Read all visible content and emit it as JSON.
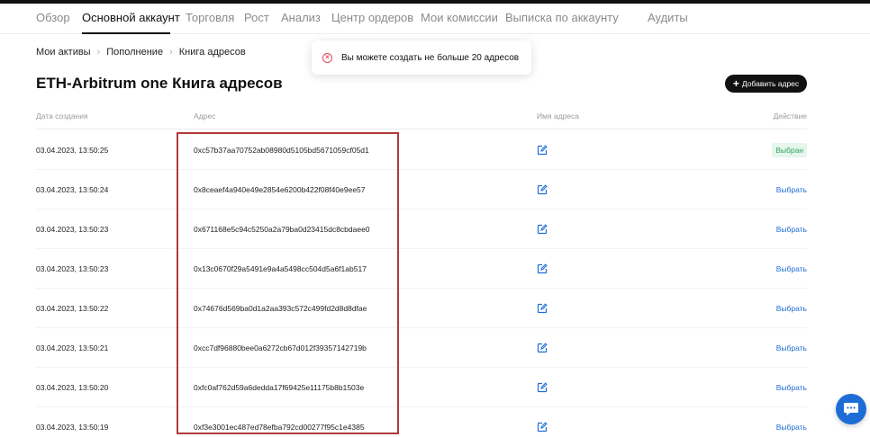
{
  "nav": {
    "tabs": [
      {
        "label": "Обзор"
      },
      {
        "label": "Основной аккаунт"
      },
      {
        "label": "Торговля"
      },
      {
        "label": "Рост"
      },
      {
        "label": "Анализ"
      },
      {
        "label": "Центр ордеров"
      },
      {
        "label": "Мои комиссии"
      },
      {
        "label": "Выписка по аккаунту"
      },
      {
        "label": "Аудиты"
      }
    ],
    "active_index": 1
  },
  "breadcrumb": {
    "items": [
      {
        "label": "Мои активы"
      },
      {
        "label": "Пополнение"
      },
      {
        "label": "Книга адресов"
      }
    ]
  },
  "page": {
    "title": "ETH-Arbitrum one Книга адресов",
    "add_button_label": "Добавить адрес"
  },
  "toast": {
    "message": "Вы можете создать не больше 20 адресов"
  },
  "table": {
    "columns": {
      "date": "Дата создания",
      "address": "Адрес",
      "name": "Имя адреса",
      "action": "Действие"
    },
    "rows": [
      {
        "date": "03.04.2023, 13:50:25",
        "address": "0xc57b37aa70752ab08980d5105bd5671059cf05d1",
        "action": "Выбран",
        "selected": true
      },
      {
        "date": "03.04.2023, 13:50:24",
        "address": "0x8ceaef4a940e49e2854e6200b422f08f40e9ee57",
        "action": "Выбрать",
        "selected": false
      },
      {
        "date": "03.04.2023, 13:50:23",
        "address": "0x671168e5c94c5250a2a79ba0d23415dc8cbdaee0",
        "action": "Выбрать",
        "selected": false
      },
      {
        "date": "03.04.2023, 13:50:23",
        "address": "0x13c0670f29a5491e9a4a5498cc504d5a6f1ab517",
        "action": "Выбрать",
        "selected": false
      },
      {
        "date": "03.04.2023, 13:50:22",
        "address": "0x74676d569ba0d1a2aa393c572c499fd2d8d8dfae",
        "action": "Выбрать",
        "selected": false
      },
      {
        "date": "03.04.2023, 13:50:21",
        "address": "0xcc7df96880bee0a6272cb67d012f39357142719b",
        "action": "Выбрать",
        "selected": false
      },
      {
        "date": "03.04.2023, 13:50:20",
        "address": "0xfc0af762d59a6dedda17f69425e11175b8b1503e",
        "action": "Выбрать",
        "selected": false
      },
      {
        "date": "03.04.2023, 13:50:19",
        "address": "0xf3e3001ec487ed78efba792cd00277f95c1e4385",
        "action": "Выбрать",
        "selected": false
      }
    ]
  },
  "colors": {
    "accent": "#1e6cd6",
    "selected_badge_bg": "#e6f6ec",
    "selected_badge_text": "#2ea862",
    "error": "#e2465a",
    "highlight": "#b23a3a"
  },
  "icons": {
    "edit": "edit-icon",
    "toast": "error-circle-icon",
    "chat": "chat-icon",
    "add": "plus-icon",
    "separator": "chevron-right-icon"
  }
}
